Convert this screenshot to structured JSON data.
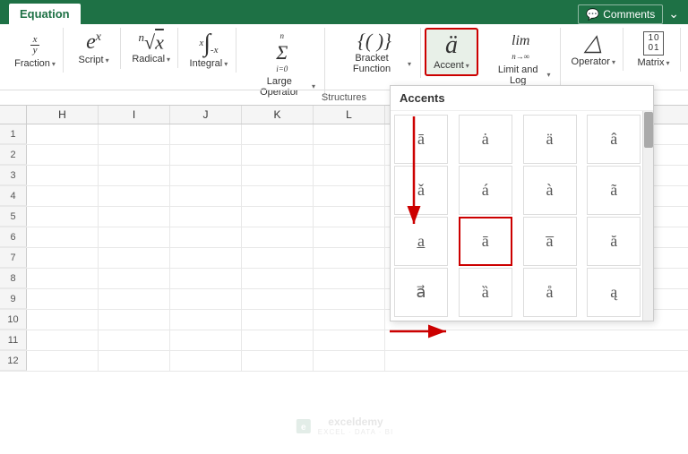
{
  "ribbon": {
    "tab_label": "Equation",
    "comments_label": "Comments",
    "groups": [
      {
        "id": "fraction",
        "symbol": "x/y",
        "label": "Fraction",
        "has_caret": true
      },
      {
        "id": "script",
        "symbol": "eˣ",
        "label": "Script",
        "has_caret": true
      },
      {
        "id": "radical",
        "symbol": "ⁿ√x",
        "label": "Radical",
        "has_caret": true
      },
      {
        "id": "integral",
        "symbol": "∫",
        "label": "Integral",
        "has_caret": true
      },
      {
        "id": "large-operator",
        "symbol": "Σ",
        "label": "Large Operator",
        "has_caret": true
      },
      {
        "id": "bracket",
        "symbol": "{()}",
        "label": "Bracket Function",
        "has_caret": true
      },
      {
        "id": "accent",
        "symbol": "ä",
        "label": "Accent",
        "has_caret": true,
        "highlighted": true
      },
      {
        "id": "limit",
        "symbol": "lim",
        "label": "Limit and Log",
        "has_caret": true
      },
      {
        "id": "operator",
        "symbol": "△",
        "label": "Operator",
        "has_caret": true
      },
      {
        "id": "matrix",
        "symbol": "[]",
        "label": "Matrix",
        "has_caret": true
      }
    ],
    "structures_label": "Structures"
  },
  "columns": [
    "H",
    "I",
    "J",
    "K",
    "L"
  ],
  "accent_dropdown": {
    "title": "Accents",
    "rows": 4,
    "cols": 4,
    "highlighted_row": 2,
    "highlighted_col": 1
  },
  "watermark": {
    "line1": "exceldemy",
    "line2": "EXCEL · DATA · BI"
  }
}
